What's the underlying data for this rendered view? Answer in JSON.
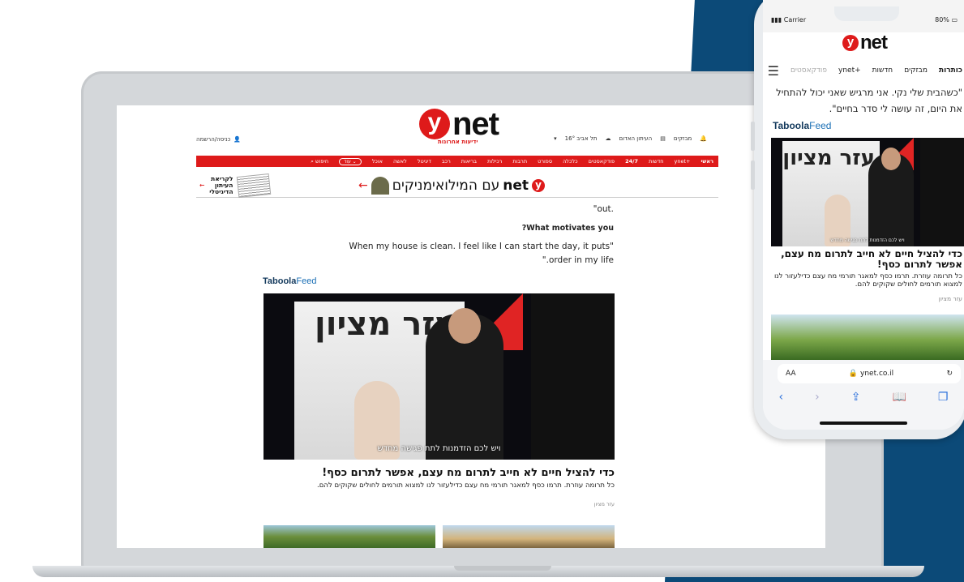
{
  "colors": {
    "brand_red": "#de1a1a",
    "bg_blue": "#0c4a78",
    "taboola_blue": "#1a6fb5"
  },
  "site": {
    "logo_y": "y",
    "logo_net": "net",
    "logo_tagline": "ידיעות אחרונות",
    "login": "כניסה/הרשמה",
    "header_right": {
      "subscribers": "מבזקים",
      "newspaper": "העיתון האדום",
      "weather": "16° תל אביב"
    },
    "nav": {
      "items": [
        "ראשי",
        "ynet+",
        "חדשות",
        "24/7",
        "פודקאסטים",
        "כלכלה",
        "ספורט",
        "תרבות",
        "רכילות",
        "בריאות",
        "רכב",
        "דיגיטל",
        "לאשה",
        "אוכל"
      ],
      "more": "עוד",
      "search": "חיפוש"
    },
    "banner": {
      "text": "עם המילואימניקים",
      "y": "y",
      "net": "net",
      "left_line1": "לקריאת",
      "left_line2": "העיתון",
      "left_line3": "הדיגיטלי"
    },
    "article": {
      "line_out": ".out\"",
      "question": "What motivates you?",
      "answer_1": "\"When my house is clean. I feel like I can start the day, it puts",
      "answer_2": "order in my life.\""
    },
    "taboola": {
      "brand": "Taboola",
      "feed": "Feed"
    },
    "hero": {
      "sign": "עזר מציון",
      "caption": "ויש לכם הזדמנות לתת פגישה מחדש"
    },
    "card": {
      "headline": "כדי להציל חיים לא חייב לתרום מח עצם, אפשר לתרום כסף!",
      "desc": "כל תרומה עוזרת. תרמו כסף למאגר תורמי מח עצם כדילעזור לנו למצוא תורמים לחולים שקוקים להם.",
      "source": "עזר מציון"
    }
  },
  "phone": {
    "carrier": "Carrier",
    "battery": "80%",
    "nav": [
      "כותרות",
      "מבזקים",
      "חדשות",
      "ynet+",
      "פודקאסטים"
    ],
    "quote": "\"כשהבית שלי נקי. אני מרגיש שאני יכול להתחיל את היום, זה עושה לי סדר בחיים\".",
    "url": "ynet.co.il",
    "aa": "AA"
  }
}
